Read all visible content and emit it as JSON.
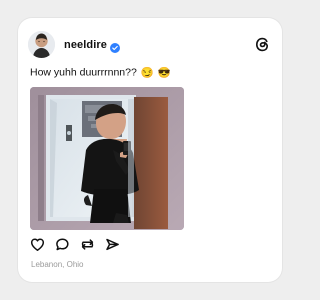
{
  "post": {
    "username": "neeldire",
    "verified": true,
    "caption": "How yuhh duurrrnnn??",
    "emojis": [
      "😏",
      "😎"
    ],
    "location": "Lebanon, Ohio"
  },
  "actions": [
    {
      "name": "like",
      "icon": "heart-icon"
    },
    {
      "name": "reply",
      "icon": "comment-icon"
    },
    {
      "name": "repost",
      "icon": "repost-icon"
    },
    {
      "name": "share",
      "icon": "send-icon"
    }
  ],
  "brand": {
    "logo": "threads-logo-icon",
    "verified_color": "#2f80ff",
    "text_color": "#111111",
    "muted_text_color": "#9b9b9b"
  }
}
